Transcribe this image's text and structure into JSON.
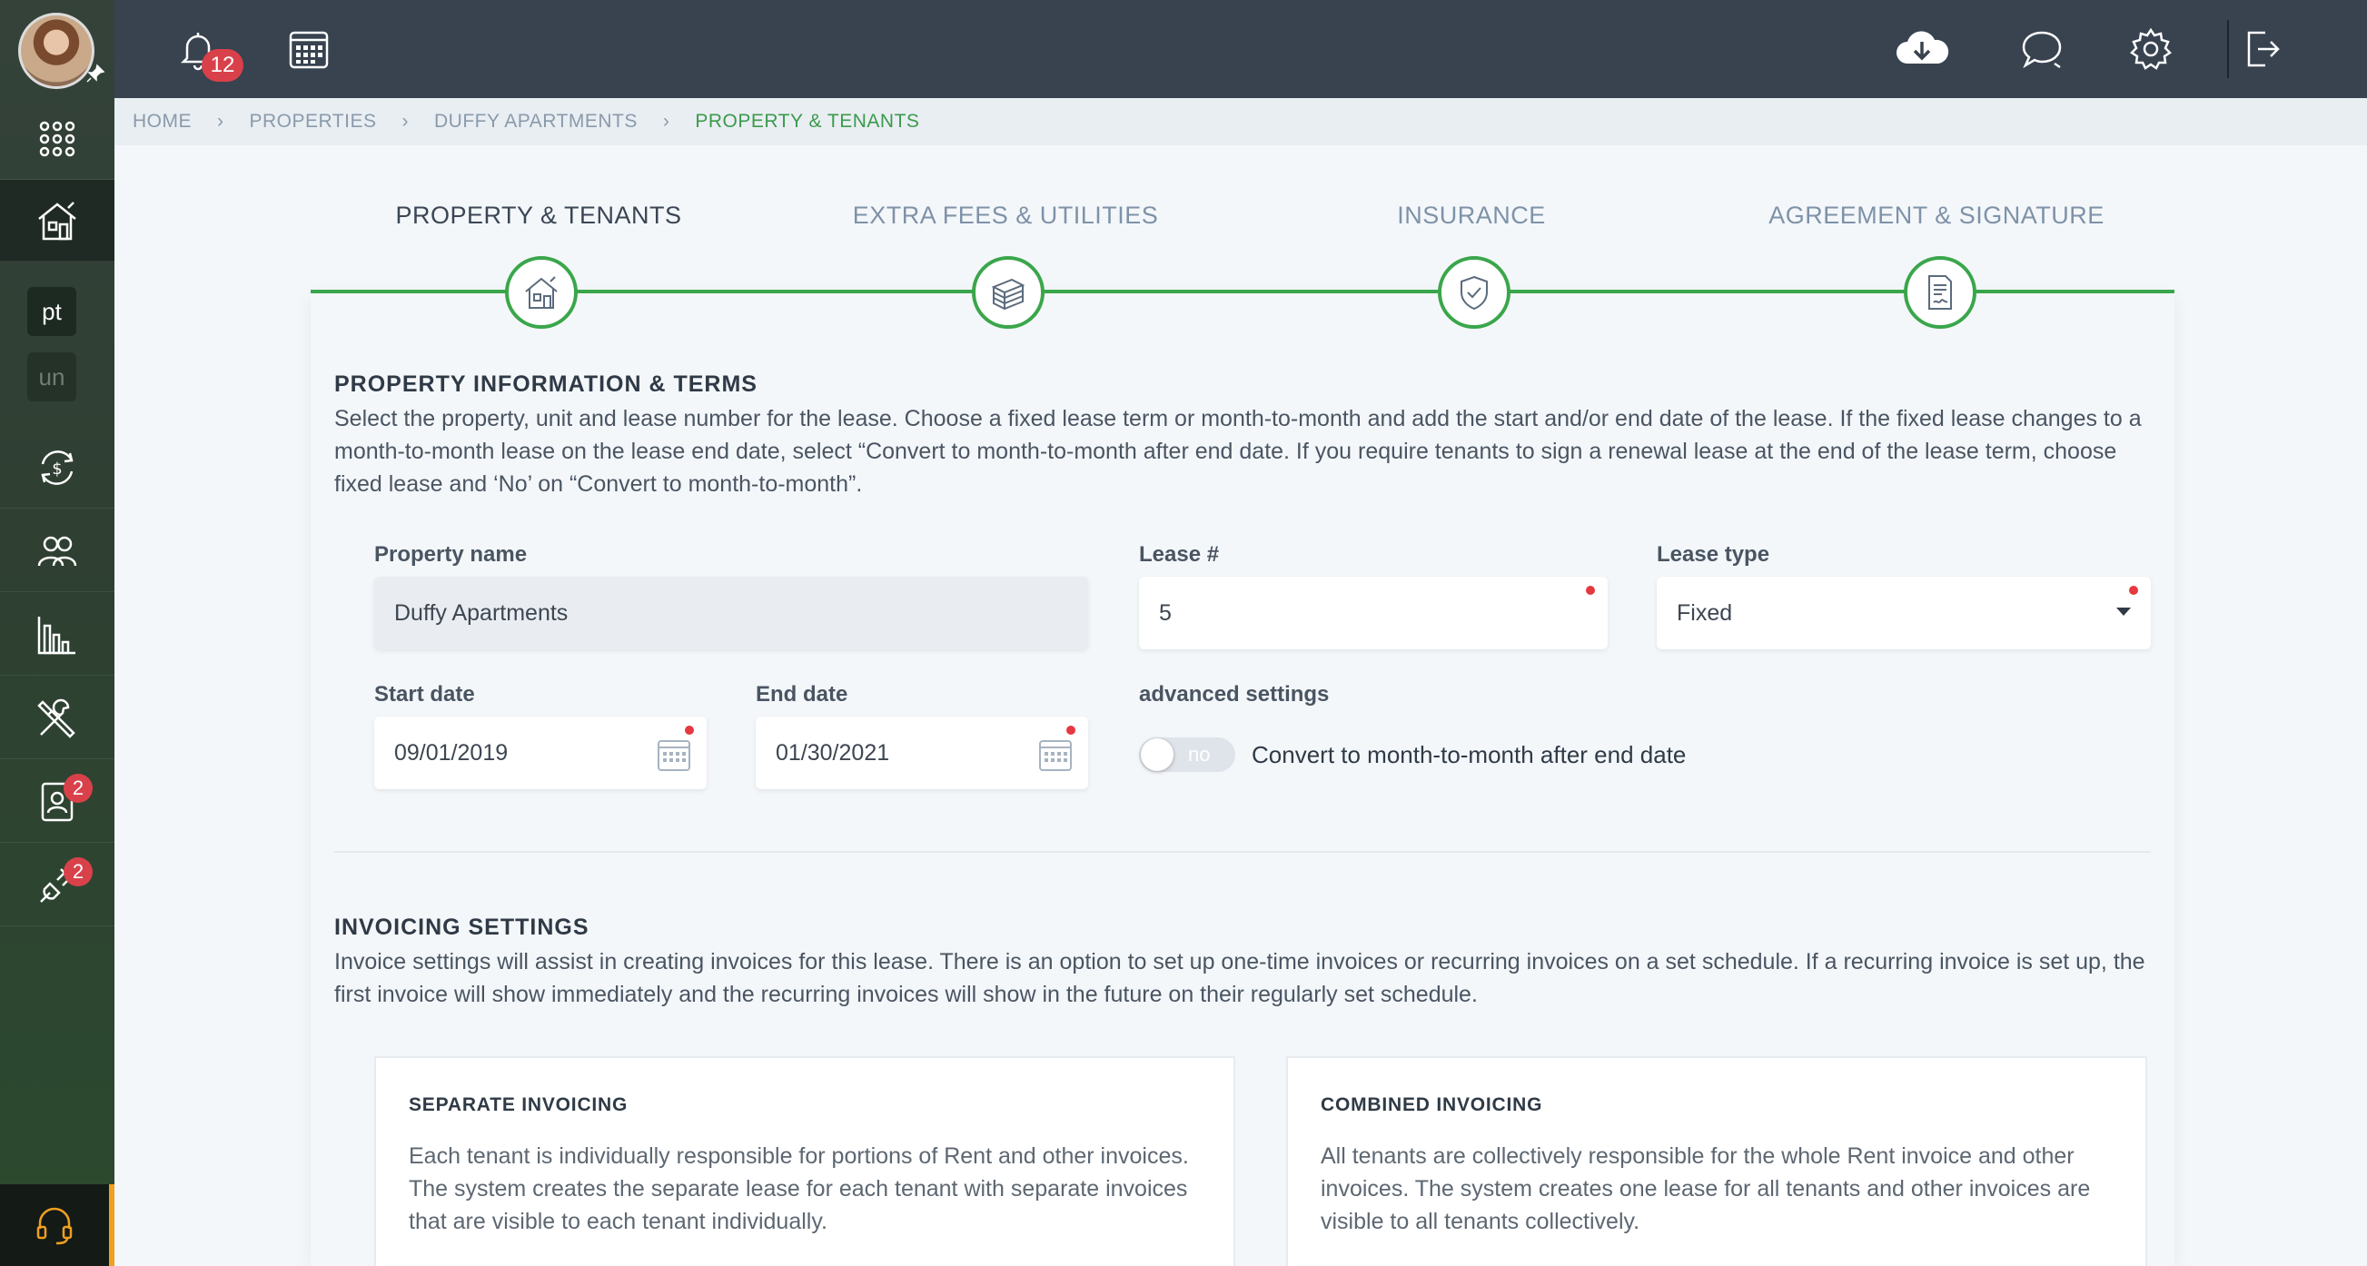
{
  "topbar": {
    "notifications_count": "12",
    "icons": [
      "bell-icon",
      "calendar-icon",
      "cloud-download-icon",
      "chat-icon",
      "gear-icon",
      "logout-icon"
    ]
  },
  "sidebar": {
    "chips": [
      "pt",
      "un"
    ],
    "badges": {
      "tenants_docs": "2",
      "maintenance": "2"
    }
  },
  "breadcrumb": [
    "HOME",
    "PROPERTIES",
    "DUFFY APARTMENTS",
    "PROPERTY & TENANTS"
  ],
  "steps": [
    {
      "label": "PROPERTY & TENANTS",
      "icon": "house-icon"
    },
    {
      "label": "EXTRA FEES & UTILITIES",
      "icon": "money-stack-icon"
    },
    {
      "label": "INSURANCE",
      "icon": "shield-check-icon"
    },
    {
      "label": "AGREEMENT & SIGNATURE",
      "icon": "document-signature-icon"
    }
  ],
  "property_section": {
    "title": "PROPERTY INFORMATION & TERMS",
    "description": "Select the property, unit and lease number for the lease. Choose a fixed lease term or month-to-month and add the start and/or end date of the lease. If the fixed lease changes to a month-to-month lease on the lease end date, select “Convert to month-to-month after end date. If you require tenants to sign a renewal lease at the end of the lease term, choose fixed lease and ‘No’ on “Convert to month-to-month”."
  },
  "form": {
    "property_name_label": "Property name",
    "property_name_value": "Duffy Apartments",
    "lease_num_label": "Lease #",
    "lease_num_value": "5",
    "lease_type_label": "Lease type",
    "lease_type_value": "Fixed",
    "start_date_label": "Start date",
    "start_date_value": "09/01/2019",
    "end_date_label": "End date",
    "end_date_value": "01/30/2021",
    "advanced_label": "advanced settings",
    "toggle_state": "no",
    "toggle_text": "Convert to month-to-month after end date"
  },
  "invoicing_section": {
    "title": "INVOICING SETTINGS",
    "description": "Invoice settings will assist in creating invoices for this lease. There is an option to set up one-time invoices or recurring invoices on a set schedule. If a recurring invoice is set up, the first invoice will show immediately and the recurring invoices will show in the future on their regularly set schedule.",
    "options": [
      {
        "title": "SEPARATE INVOICING",
        "text": "Each tenant is individually responsible for portions of Rent and other invoices. The system creates the separate lease for each tenant with separate invoices that are visible to each tenant individually."
      },
      {
        "title": "COMBINED INVOICING",
        "text": "All tenants are collectively responsible for the whole Rent invoice and other invoices. The system creates one lease for all tenants and other invoices are visible to all tenants collectively."
      }
    ]
  },
  "colors": {
    "accent": "#3aa64b",
    "topbar": "#38434f",
    "badge": "#d9414a",
    "required": "#e5383f"
  }
}
